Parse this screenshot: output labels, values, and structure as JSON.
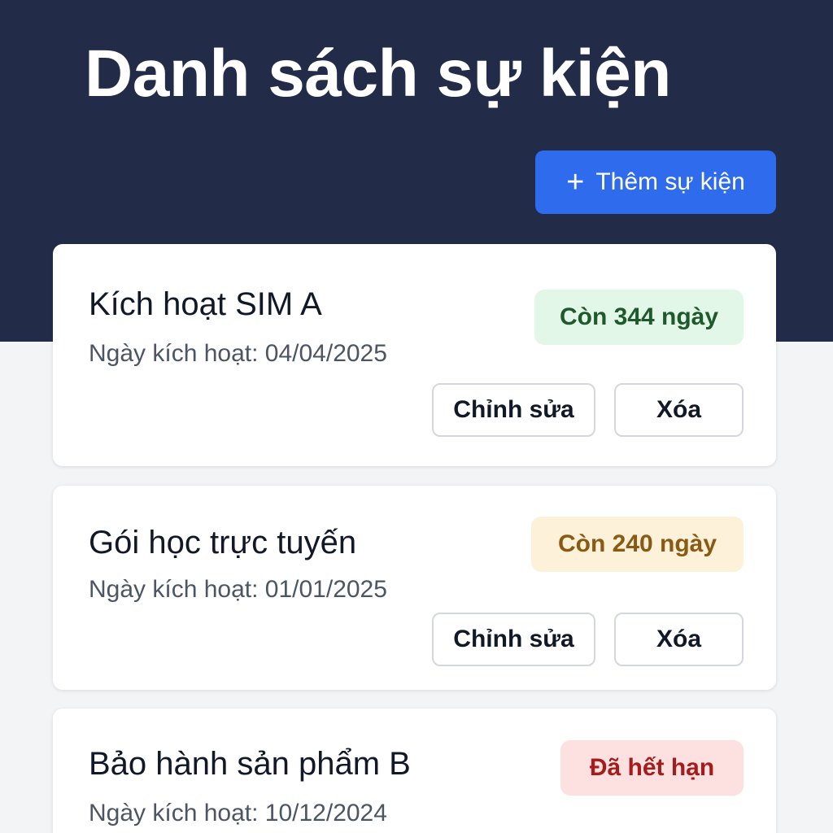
{
  "header": {
    "title": "Danh sách sự kiện",
    "add_button_label": "Thêm sự kiện",
    "add_button_icon": "plus-icon",
    "background_color": "#222b48",
    "accent_color": "#2f6bed"
  },
  "events": [
    {
      "title": "Kích hoạt SIM A",
      "date_label": "Ngày kích hoạt: 04/04/2025",
      "status": "Còn 344 ngày",
      "status_bg": "#e3f7e9",
      "status_fg": "#1f5a2c",
      "edit_label": "Chỉnh sửa",
      "delete_label": "Xóa"
    },
    {
      "title": "Gói học trực tuyến",
      "date_label": "Ngày kích hoạt: 01/01/2025",
      "status": "Còn 240 ngày",
      "status_bg": "#fdf1d9",
      "status_fg": "#8a5a12",
      "edit_label": "Chỉnh sửa",
      "delete_label": "Xóa"
    },
    {
      "title": "Bảo hành sản phẩm B",
      "date_label": "Ngày kích hoạt: 10/12/2024",
      "status": "Đã hết hạn",
      "status_bg": "#fde1e1",
      "status_fg": "#a61b1b"
    }
  ]
}
